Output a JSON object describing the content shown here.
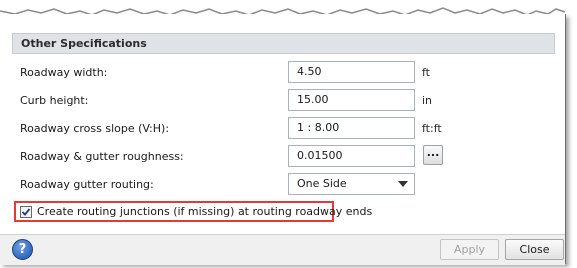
{
  "section": {
    "title": "Other Specifications"
  },
  "rows": [
    {
      "label": "Roadway width:",
      "value": "4.50",
      "unit": "ft"
    },
    {
      "label": "Curb height:",
      "value": "15.00",
      "unit": "in"
    },
    {
      "label": "Roadway cross slope (V:H):",
      "value": "1 : 8.00",
      "unit": "ft:ft"
    },
    {
      "label": "Roadway & gutter roughness:",
      "value": "0.01500",
      "button": "..."
    },
    {
      "label": "Roadway gutter routing:",
      "selected": "One Side"
    }
  ],
  "checkbox": {
    "label": "Create routing junctions (if missing) at routing roadway ends",
    "checked": true
  },
  "footer": {
    "help": "?",
    "apply": "Apply",
    "close": "Close"
  },
  "colors": {
    "highlight": "#e23a3a",
    "header_bg": "#dfe3e8",
    "help_blue": "#1d4fa8"
  }
}
